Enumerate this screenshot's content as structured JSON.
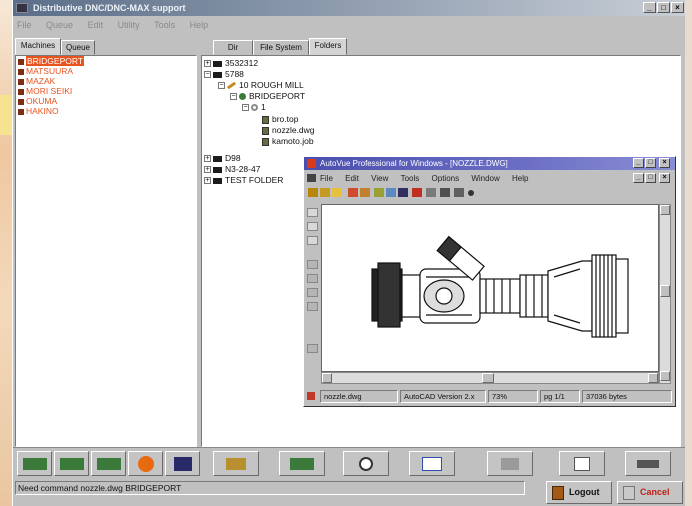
{
  "window": {
    "title": "Distributive DNC/DNC-MAX support",
    "min": "_",
    "max": "□",
    "close": "×"
  },
  "menu": [
    "File",
    "Queue",
    "Edit",
    "Utility",
    "Tools",
    "Help"
  ],
  "left_panel": {
    "tabs": [
      "Machines",
      "Queue"
    ],
    "machines": [
      "BRIDGEPORT",
      "MATSUURA",
      "MAZAK",
      "MORI SEIKI",
      "OKUMA",
      "HAKINO"
    ]
  },
  "right_panel": {
    "tabs": [
      "Dir",
      "File System",
      "Folders"
    ],
    "tree": {
      "n1": "3532312",
      "n2": "5788",
      "n3": "10 ROUGH MILL",
      "n4": "BRIDGEPORT",
      "n5": "1",
      "n6": "bro.top",
      "n7": "nozzle.dwg",
      "n8": "kamoto.job",
      "n9": "D98",
      "n10": "N3-28-47",
      "n11": "TEST FOLDER"
    }
  },
  "autovue": {
    "title": "AutoVue Professional for Windows - [NOZZLE.DWG]",
    "menu": [
      "File",
      "Edit",
      "View",
      "Tools",
      "Options",
      "Window",
      "Help"
    ],
    "status": [
      "nozzle.dwg",
      "AutoCAD Version 2.x",
      "73%",
      "pg 1/1",
      "37036 bytes"
    ]
  },
  "status_text": "Need command nozzle.dwg BRIDGEPORT",
  "buttons": {
    "logout": "Logout",
    "cancel": "Cancel"
  },
  "toolbar_icons": [
    "send-to-machine-icon",
    "receive-from-machine-icon",
    "compare-icon",
    "stop-icon",
    "monitor-icon",
    "edit-icon",
    "transfer-icon",
    "view-icon",
    "approve-icon",
    "print-icon",
    "notes-icon",
    "exit-icon"
  ],
  "colors": {
    "machine_text": "#e8531e",
    "autovue_title": "#4a4fae",
    "window_title": "#5b6e88"
  }
}
